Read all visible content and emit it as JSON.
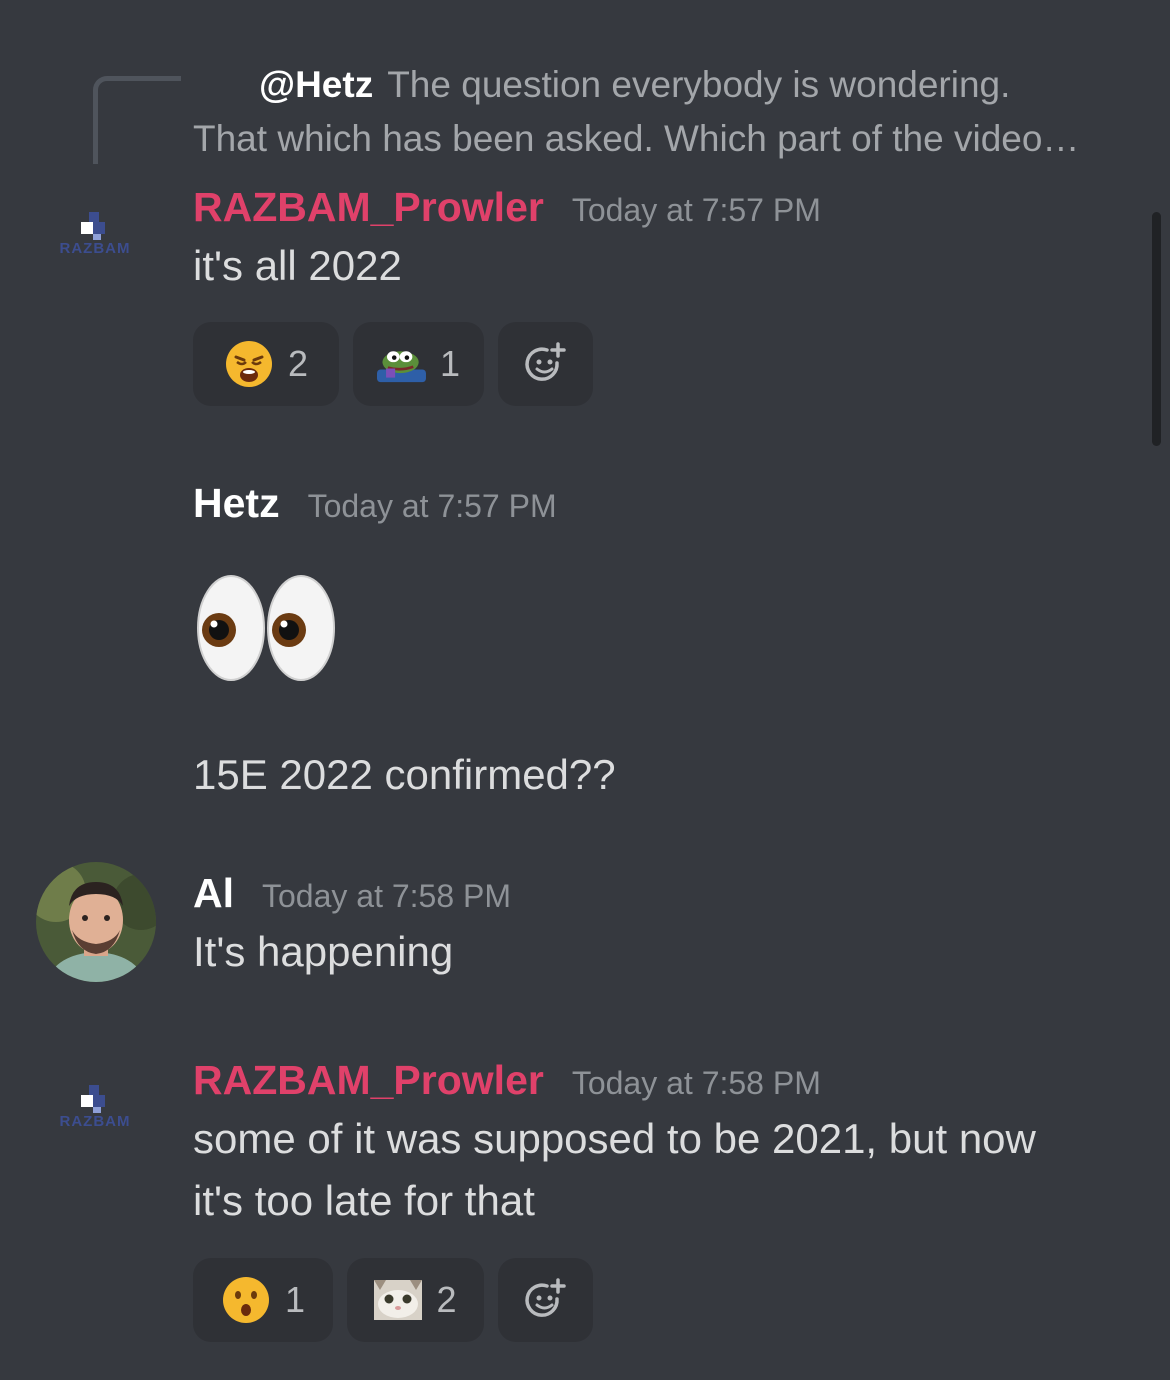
{
  "reply": {
    "mention": "@Hetz",
    "line1": "The question everybody is wondering.",
    "line2": "That which has been asked. Which part of the video…"
  },
  "messages": [
    {
      "author": "RAZBAM_Prowler",
      "author_color": "#e0416a",
      "avatar_text": "RAZBAM",
      "timestamp": "Today at 7:57 PM",
      "lines": [
        "it's all 2022"
      ],
      "reactions": [
        {
          "emoji": "weary-face",
          "count": "2"
        },
        {
          "emoji": "pepe-frog",
          "count": "1"
        }
      ]
    },
    {
      "author": "Hetz",
      "author_color": "#ffffff",
      "timestamp": "Today at 7:57 PM",
      "emoji": "eyes",
      "lines": [
        "15E 2022 confirmed??"
      ]
    },
    {
      "author": "Al",
      "author_color": "#ffffff",
      "timestamp": "Today at 7:58 PM",
      "lines": [
        "It's happening"
      ]
    },
    {
      "author": "RAZBAM_Prowler",
      "author_color": "#e0416a",
      "avatar_text": "RAZBAM",
      "timestamp": "Today at 7:58 PM",
      "lines": [
        "some of it was supposed to be 2021, but now",
        "it's too late for that"
      ],
      "reactions": [
        {
          "emoji": "hushed-face",
          "count": "1"
        },
        {
          "emoji": "cat-face",
          "count": "2"
        }
      ]
    }
  ],
  "icons": {
    "add_reaction": "add-reaction-icon"
  }
}
